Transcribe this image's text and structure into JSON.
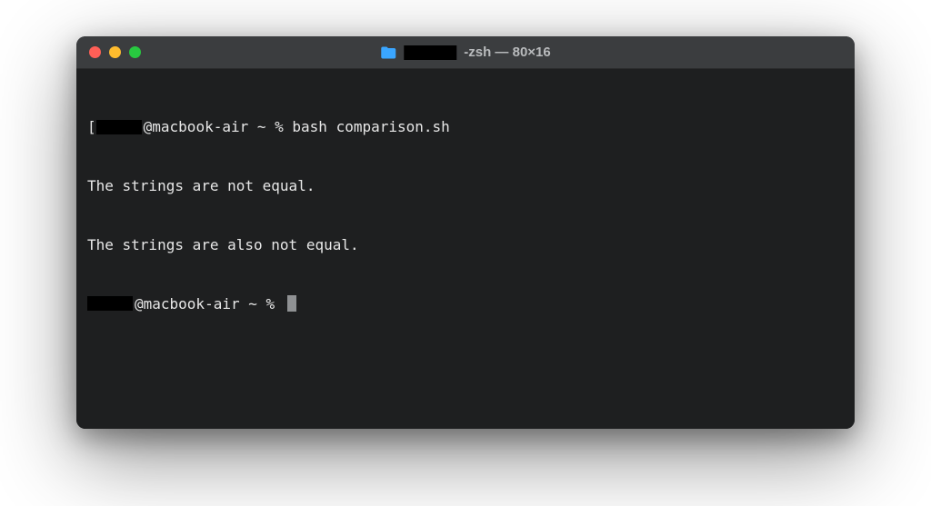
{
  "titlebar": {
    "title_suffix": " -zsh — 80×16"
  },
  "terminal": {
    "prompt_host_part": "@macbook-air ~ % ",
    "command": "bash comparison.sh",
    "output_line1": "The strings are not equal.",
    "output_line2": "The strings are also not equal.",
    "prompt_host_part2": "@macbook-air ~ % "
  }
}
